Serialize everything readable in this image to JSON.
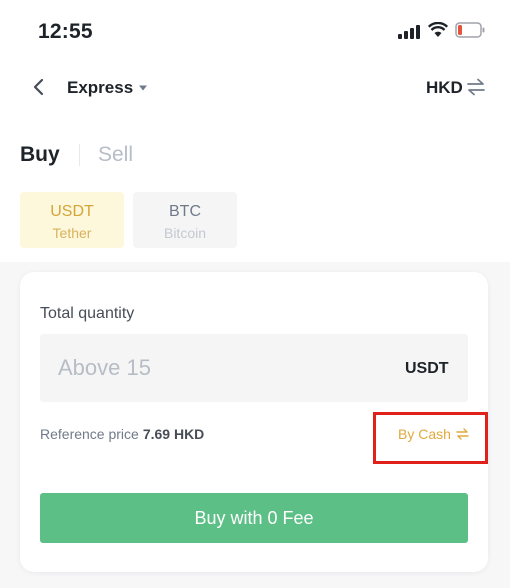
{
  "status_bar": {
    "time": "12:55"
  },
  "header": {
    "mode_label": "Express",
    "fiat_currency": "HKD"
  },
  "tabs": {
    "buy": "Buy",
    "sell": "Sell",
    "active": "Buy"
  },
  "assets": [
    {
      "symbol": "USDT",
      "name": "Tether",
      "selected": true
    },
    {
      "symbol": "BTC",
      "name": "Bitcoin",
      "selected": false
    }
  ],
  "order": {
    "quantity_label": "Total quantity",
    "quantity_placeholder": "Above 15",
    "quantity_unit": "USDT",
    "reference_price_label": "Reference price",
    "reference_price_value": "7.69 HKD",
    "payment_method": "By Cash",
    "submit_label": "Buy with 0 Fee"
  },
  "colors": {
    "accent": "#e0a93b",
    "buy_button": "#5cbf86",
    "highlight_box": "#e0201a"
  }
}
